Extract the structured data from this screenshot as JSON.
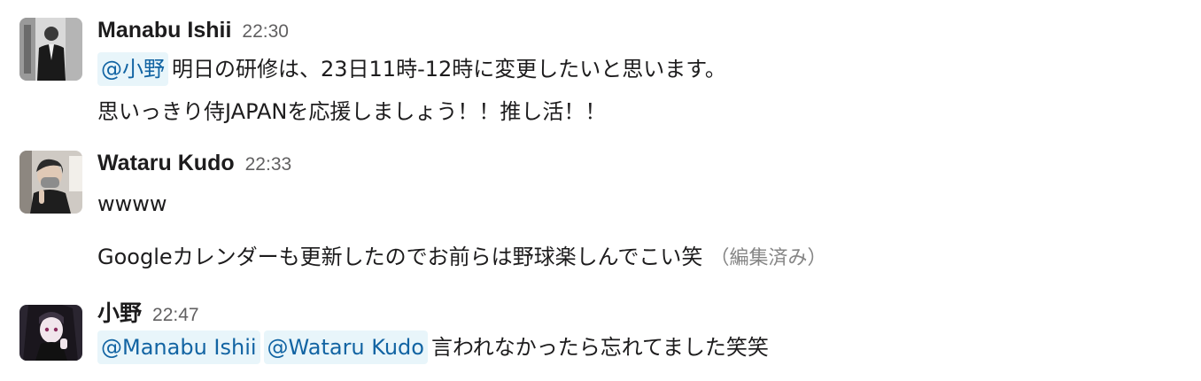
{
  "messages": [
    {
      "author": "Manabu Ishii",
      "time": "22:30",
      "avatar": "photo-avatar-manabu",
      "lines": [
        {
          "mention": "@小野",
          "text": "明日の研修は、23日11時-12時に変更したいと思います。"
        },
        {
          "text": "思いっきり侍JAPANを応援しましょう！！推し活！！"
        }
      ]
    },
    {
      "author": "Wataru Kudo",
      "time": "22:33",
      "avatar": "photo-avatar-wataru",
      "lines": [
        {
          "text": "wwww"
        },
        {
          "text": "Googleカレンダーも更新したのでお前らは野球楽しんでこい笑",
          "edited": "（編集済み）"
        }
      ]
    },
    {
      "author": "小野",
      "time": "22:47",
      "avatar": "illustration-avatar-ono",
      "lines": [
        {
          "mentions": [
            "@Manabu Ishii",
            "@Wataru Kudo"
          ],
          "text": "言われなかったら忘れてました笑笑"
        }
      ]
    }
  ],
  "colors": {
    "mention_bg": "#e8f5fa",
    "mention_text": "#1264a3",
    "timestamp": "#616061",
    "edited": "#868686"
  }
}
